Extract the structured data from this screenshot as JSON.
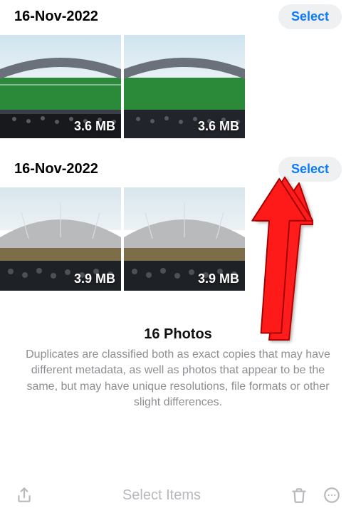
{
  "groups": [
    {
      "date": "16-Nov-2022",
      "select_label": "Select",
      "photos": [
        {
          "size": "3.6 MB"
        },
        {
          "size": "3.6 MB"
        }
      ]
    },
    {
      "date": "16-Nov-2022",
      "select_label": "Select",
      "photos": [
        {
          "size": "3.9 MB"
        },
        {
          "size": "3.9 MB"
        }
      ]
    }
  ],
  "summary": {
    "title": "16 Photos",
    "description": "Duplicates are classified both as exact copies that may have different metadata, as well as photos that appear to be the same, but may have unique resolutions, file formats or other slight differences."
  },
  "toolbar": {
    "center_label": "Select Items"
  }
}
